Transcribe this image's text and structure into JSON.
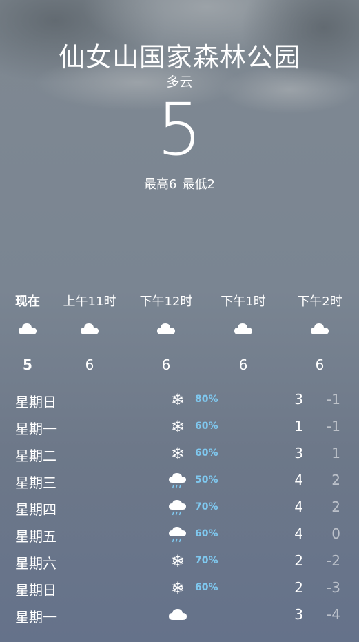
{
  "header": {
    "location": "仙女山国家森林公园",
    "condition": "多云",
    "temperature": "5",
    "high_label": "最高6",
    "low_label": "最低2"
  },
  "hourly": [
    {
      "label": "现在",
      "icon": "cloud-icon",
      "temp": "5",
      "is_now": true
    },
    {
      "label": "上午11时",
      "icon": "cloud-icon",
      "temp": "6"
    },
    {
      "label": "下午12时",
      "icon": "cloud-icon",
      "temp": "6"
    },
    {
      "label": "下午1时",
      "icon": "cloud-icon",
      "temp": "6"
    },
    {
      "label": "下午2时",
      "icon": "cloud-icon",
      "temp": "6"
    }
  ],
  "daily": [
    {
      "day": "星期日",
      "icon": "snowflake-icon",
      "precip": "80%",
      "high": "3",
      "low": "-1"
    },
    {
      "day": "星期一",
      "icon": "snowflake-icon",
      "precip": "60%",
      "high": "1",
      "low": "-1"
    },
    {
      "day": "星期二",
      "icon": "snowflake-icon",
      "precip": "60%",
      "high": "3",
      "low": "1"
    },
    {
      "day": "星期三",
      "icon": "cloud-rain-icon",
      "precip": "50%",
      "high": "4",
      "low": "2"
    },
    {
      "day": "星期四",
      "icon": "cloud-rain-icon",
      "precip": "70%",
      "high": "4",
      "low": "2"
    },
    {
      "day": "星期五",
      "icon": "cloud-rain-icon",
      "precip": "60%",
      "high": "4",
      "low": "0"
    },
    {
      "day": "星期六",
      "icon": "snowflake-icon",
      "precip": "70%",
      "high": "2",
      "low": "-2"
    },
    {
      "day": "星期日",
      "icon": "snowflake-icon",
      "precip": "60%",
      "high": "2",
      "low": "-3"
    },
    {
      "day": "星期一",
      "icon": "cloud-icon",
      "precip": "",
      "high": "3",
      "low": "-4"
    }
  ],
  "colors": {
    "background": "#7a8592",
    "precip_accent": "#7fc8ef",
    "low_temp": "#c4c9d0"
  }
}
